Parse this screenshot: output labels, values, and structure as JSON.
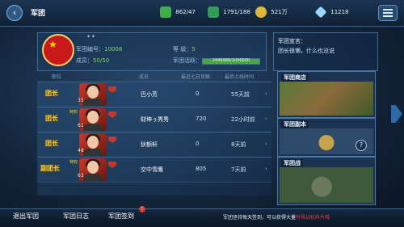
{
  "header": {
    "back": "‹",
    "title": "军团",
    "resources": [
      {
        "name": "energy",
        "icon": "green-crystal-icon",
        "value": "862/47",
        "color": "#3fae4a"
      },
      {
        "name": "stamina",
        "icon": "green-card-icon",
        "value": "1791/188",
        "color": "#2f9e55"
      },
      {
        "name": "gold",
        "icon": "gold-coin-icon",
        "value": "521万",
        "color": "#e1b53a"
      },
      {
        "name": "diamond",
        "icon": "diamond-icon",
        "value": "11218",
        "color": "#9bd8ff"
      }
    ]
  },
  "legion": {
    "name": "* *",
    "id_label": "军团编号：",
    "id_value": "10008",
    "level_label": "等    级：",
    "level_value": "5",
    "members_label": "成员：",
    "members_value": "50/50",
    "activity_label": "军团活跃：",
    "activity_value": "2449986/1000000",
    "activity_fraction": 1.0
  },
  "notice": {
    "title": "军团宣言：",
    "text": "团长很懒，什么也没说"
  },
  "table": {
    "headers": [
      "职位",
      "成员",
      "最近七日贡献",
      "最后上线时间"
    ],
    "rows": [
      {
        "rank": "团长",
        "level": "35",
        "name": "巴小芳",
        "contrib": "0",
        "online": "55天前",
        "tag": ""
      },
      {
        "rank": "团长",
        "level": "61",
        "name": "财坤ぅ秀秀",
        "contrib": "720",
        "online": "22小时前",
        "tag": "特权"
      },
      {
        "rank": "团长",
        "level": "48",
        "name": "狄额轩",
        "contrib": "0",
        "online": "8天前",
        "tag": ""
      },
      {
        "rank": "副团长",
        "level": "63",
        "name": "空中雪鹰",
        "contrib": "805",
        "online": "7天前",
        "tag": "特权"
      }
    ]
  },
  "side": {
    "shop": "军团商店",
    "dungeon": "军团副本",
    "war": "军团战",
    "help": "?"
  },
  "bottom": {
    "exit": "退出军团",
    "log": "军团日志",
    "signin": "军团签到",
    "badge": "!",
    "tip_prefix": "军团坚持每天签到，可以获得大量",
    "tip_highlight": "特殊战机碎片哦"
  }
}
